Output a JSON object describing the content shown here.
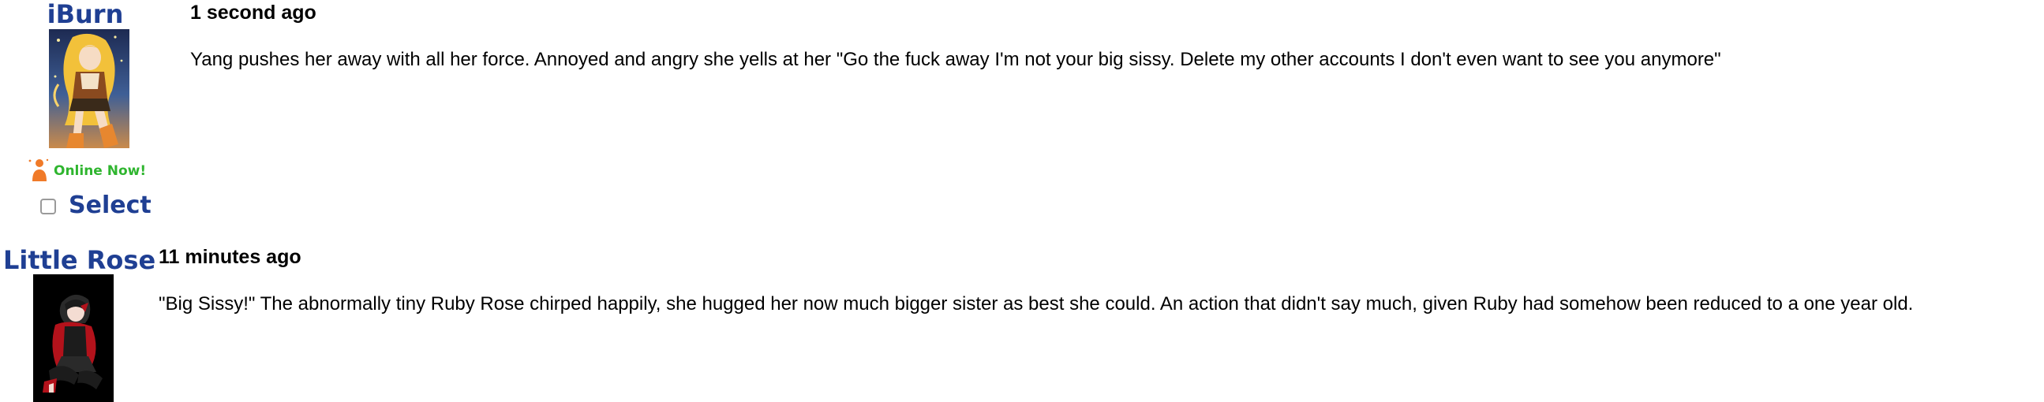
{
  "posts": [
    {
      "username": "iBurn",
      "avatar": "yang-anime-avatar",
      "status": "Online Now!",
      "status_color": "#2fb52f",
      "select_label": "Select",
      "select_checked": false,
      "timestamp": "1 second ago",
      "message": "Yang pushes her away with all her force. Annoyed and angry she yells at her \"Go the fuck away I'm not your big sissy. Delete my other accounts I don't even want to see you anymore\""
    },
    {
      "username": "Little Rose",
      "avatar": "ruby-rose-chibi-avatar",
      "timestamp": "11 minutes ago",
      "message": "\"Big Sissy!\" The abnormally tiny Ruby Rose chirped happily, she hugged her now much bigger sister as best she could. An action that didn't say much, given Ruby had somehow been reduced to a one year old."
    }
  ],
  "colors": {
    "username": "#1f3f93",
    "online_icon": "#f07a28",
    "text": "#000000"
  },
  "icons": {
    "online": "person-online-icon",
    "checkbox": "checkbox-icon"
  }
}
